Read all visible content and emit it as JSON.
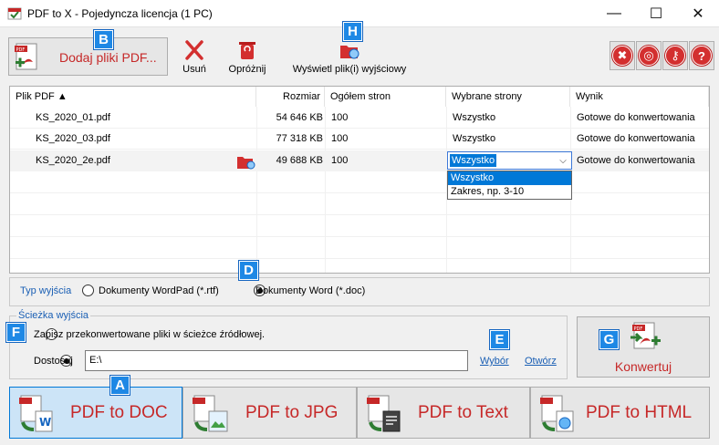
{
  "window": {
    "title": "PDF to X - Pojedyncza licencja (1 PC)",
    "minimize": "—",
    "maximize": "☐",
    "close": "✕"
  },
  "toolbar": {
    "add_pdf": "Dodaj pliki PDF...",
    "remove": "Usuń",
    "clear": "Opróżnij",
    "show_output": "Wyświetl plik(i) wyjściowy",
    "round_buttons": [
      "tools",
      "web",
      "key",
      "help"
    ]
  },
  "badges": {
    "A": "A",
    "B": "B",
    "D": "D",
    "E": "E",
    "F": "F",
    "G": "G",
    "H": "H"
  },
  "table": {
    "columns": [
      "Plik PDF ▲",
      "Rozmiar",
      "Ogółem stron",
      "Wybrane strony",
      "Wynik"
    ],
    "rows": [
      {
        "file": "KS_2020_01.pdf",
        "size": "54 646 KB",
        "pages": "100",
        "selected": "Wszystko",
        "result": "Gotowe do konwertowania"
      },
      {
        "file": "KS_2020_03.pdf",
        "size": "77 318 KB",
        "pages": "100",
        "selected": "Wszystko",
        "result": "Gotowe do konwertowania"
      },
      {
        "file": "KS_2020_2e.pdf",
        "size": "49 688 KB",
        "pages": "100",
        "selected": "Wszystko",
        "result": "Gotowe do konwertowania"
      }
    ],
    "dropdown_options": [
      "Wszystko",
      "Zakres, np. 3-10"
    ]
  },
  "output_type": {
    "label": "Typ wyjścia",
    "option_rtf": "Dokumenty WordPad (*.rtf)",
    "option_doc": "Dokumenty Word (*.doc)",
    "selected": "doc"
  },
  "output_path": {
    "label": "Ścieżka wyjścia",
    "save_source": "Zapisz przekonwertowane pliki w ścieżce źródłowej.",
    "custom": "Dostosuj",
    "path": "E:\\",
    "browse": "Wybór",
    "open": "Otwórz"
  },
  "convert": {
    "label": "Konwertuj"
  },
  "formats": [
    {
      "label": "PDF to DOC",
      "active": true
    },
    {
      "label": "PDF to JPG",
      "active": false
    },
    {
      "label": "PDF to Text",
      "active": false
    },
    {
      "label": "PDF to HTML",
      "active": false
    }
  ],
  "colors": {
    "accent_red": "#c62828",
    "badge_blue": "#1e88e5",
    "selection_blue": "#0078d7",
    "link_blue": "#1a5fb4"
  }
}
